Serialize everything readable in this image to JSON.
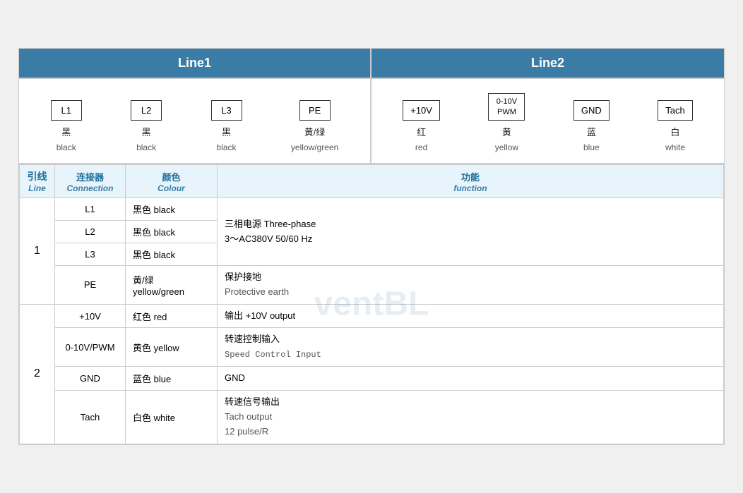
{
  "header": {
    "line1_label": "Line1",
    "line2_label": "Line2"
  },
  "line1_connectors": [
    {
      "id": "conn-L1",
      "label": "L1",
      "cn": "黑",
      "en": "black"
    },
    {
      "id": "conn-L2",
      "label": "L2",
      "cn": "黑",
      "en": "black"
    },
    {
      "id": "conn-L3",
      "label": "L3",
      "cn": "黑",
      "en": "black"
    },
    {
      "id": "conn-PE",
      "label": "PE",
      "cn": "黄/绿",
      "en": "yellow/green"
    }
  ],
  "line2_connectors": [
    {
      "id": "conn-10V",
      "label": "+10V",
      "cn": "红",
      "en": "red"
    },
    {
      "id": "conn-PWM",
      "label": "0-10V\nPWM",
      "cn": "黄",
      "en": "yellow"
    },
    {
      "id": "conn-GND",
      "label": "GND",
      "cn": "蓝",
      "en": "blue"
    },
    {
      "id": "conn-Tach",
      "label": "Tach",
      "cn": "白",
      "en": "white"
    }
  ],
  "table": {
    "headers": [
      {
        "cn": "引线",
        "en": "Line"
      },
      {
        "cn": "连接器",
        "en": "Connection"
      },
      {
        "cn": "颜色",
        "en": "Colour"
      },
      {
        "cn": "功能",
        "en": "function"
      }
    ],
    "rows": [
      {
        "line": "1",
        "rowspan": 4,
        "entries": [
          {
            "conn": "L1",
            "color_cn": "黑色 black",
            "func_cn": "三相电源 Three-phase",
            "func_en": "3～AC380V 50/60 Hz",
            "func_extra": ""
          },
          {
            "conn": "L2",
            "color_cn": "黑色 black",
            "func_cn": "",
            "func_en": "",
            "func_extra": ""
          },
          {
            "conn": "L3",
            "color_cn": "黑色 black",
            "func_cn": "",
            "func_en": "",
            "func_extra": ""
          },
          {
            "conn": "PE",
            "color_cn": "黄/绿\nyellow/green",
            "func_cn": "保护接地",
            "func_en": "Protective earth",
            "func_extra": ""
          }
        ]
      },
      {
        "line": "2",
        "rowspan": 4,
        "entries": [
          {
            "conn": "+10V",
            "color_cn": "红色 red",
            "func_cn": "输出 +10V output",
            "func_en": "",
            "func_extra": ""
          },
          {
            "conn": "0-10V/PWM",
            "color_cn": "黄色 yellow",
            "func_cn": "转速控制输入",
            "func_en": "Speed Control Input",
            "func_extra": ""
          },
          {
            "conn": "GND",
            "color_cn": "蓝色 blue",
            "func_cn": "GND",
            "func_en": "",
            "func_extra": ""
          },
          {
            "conn": "Tach",
            "color_cn": "白色 white",
            "func_cn": "转速信号输出",
            "func_en": "Tach output",
            "func_extra": "12 pulse/R"
          }
        ]
      }
    ]
  }
}
